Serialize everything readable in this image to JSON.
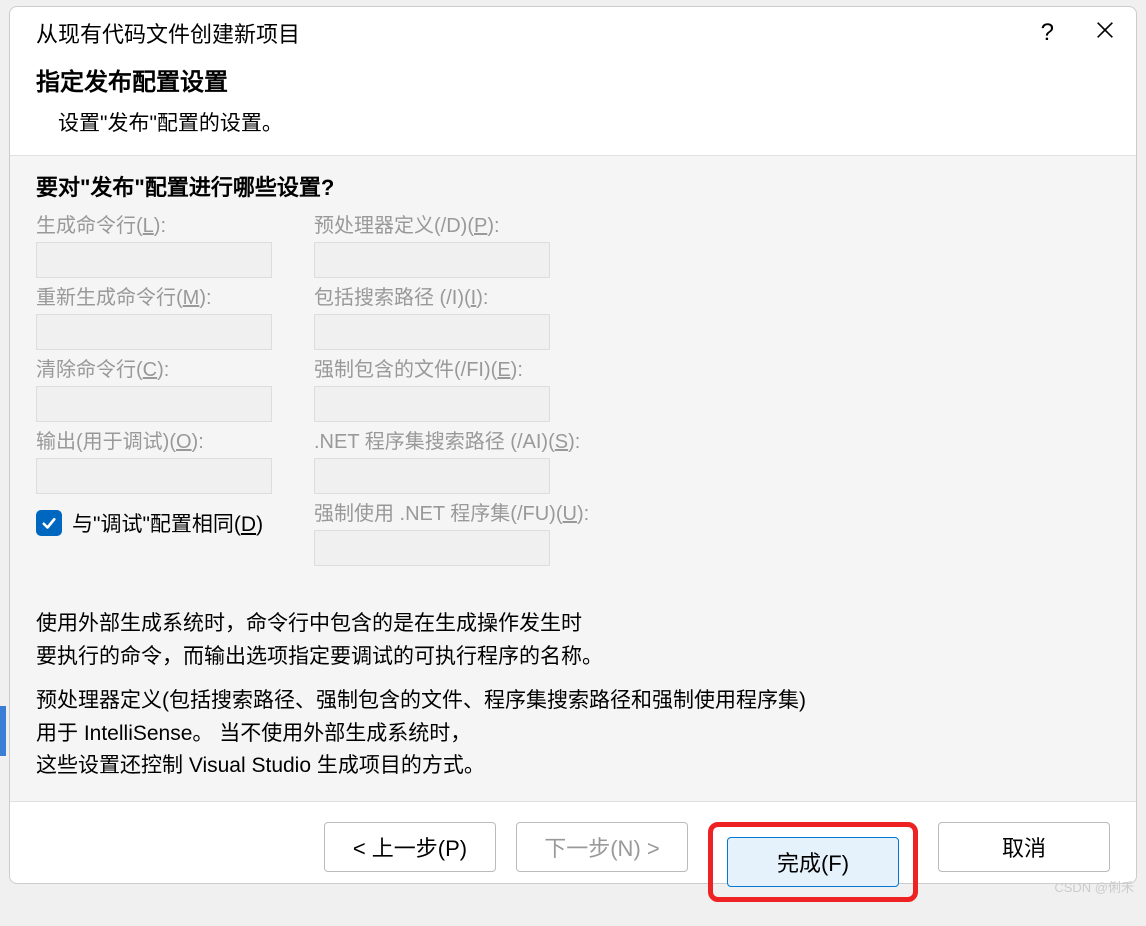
{
  "titleBar": {
    "title": "从现有代码文件创建新项目"
  },
  "header": {
    "title": "指定发布配置设置",
    "subtitle": "设置\"发布\"配置的设置。"
  },
  "question": "要对\"发布\"配置进行哪些设置?",
  "fields": {
    "buildCmd": {
      "labelBefore": "生成命令行(",
      "hotkey": "L",
      "labelAfter": "):",
      "value": ""
    },
    "preproc": {
      "labelBefore": "预处理器定义(/D)(",
      "hotkey": "P",
      "labelAfter": "):",
      "value": ""
    },
    "rebuildCmd": {
      "labelBefore": "重新生成命令行(",
      "hotkey": "M",
      "labelAfter": "):",
      "value": ""
    },
    "includePath": {
      "labelBefore": "包括搜索路径 (/I)(",
      "hotkey": "I",
      "labelAfter": "):",
      "value": ""
    },
    "cleanCmd": {
      "labelBefore": "清除命令行(",
      "hotkey": "C",
      "labelAfter": "):",
      "value": ""
    },
    "forceInclude": {
      "labelBefore": "强制包含的文件(/FI)(",
      "hotkey": "E",
      "labelAfter": "):",
      "value": ""
    },
    "output": {
      "labelBefore": "输出(用于调试)(",
      "hotkey": "O",
      "labelAfter": "):",
      "value": ""
    },
    "netSearch": {
      "labelBefore": ".NET 程序集搜索路径 (/AI)(",
      "hotkey": "S",
      "labelAfter": "):",
      "value": ""
    },
    "netForce": {
      "labelBefore": "强制使用 .NET 程序集(/FU)(",
      "hotkey": "U",
      "labelAfter": "):",
      "value": ""
    }
  },
  "checkbox": {
    "checked": true,
    "labelBefore": "与\"调试\"配置相同(",
    "hotkey": "D",
    "labelAfter": ")"
  },
  "helpText": {
    "line1": "使用外部生成系统时，命令行中包含的是在生成操作发生时",
    "line2": "要执行的命令，而输出选项指定要调试的可执行程序的名称。",
    "line3": "预处理器定义(包括搜索路径、强制包含的文件、程序集搜索路径和强制使用程序集)",
    "line4": "用于 IntelliSense。 当不使用外部生成系统时，",
    "line5": "这些设置还控制 Visual Studio 生成项目的方式。"
  },
  "buttons": {
    "back": "< 上一步(P)",
    "next": "下一步(N) >",
    "finish": "完成(F)",
    "cancel": "取消"
  },
  "watermark": "CSDN @俐禾"
}
